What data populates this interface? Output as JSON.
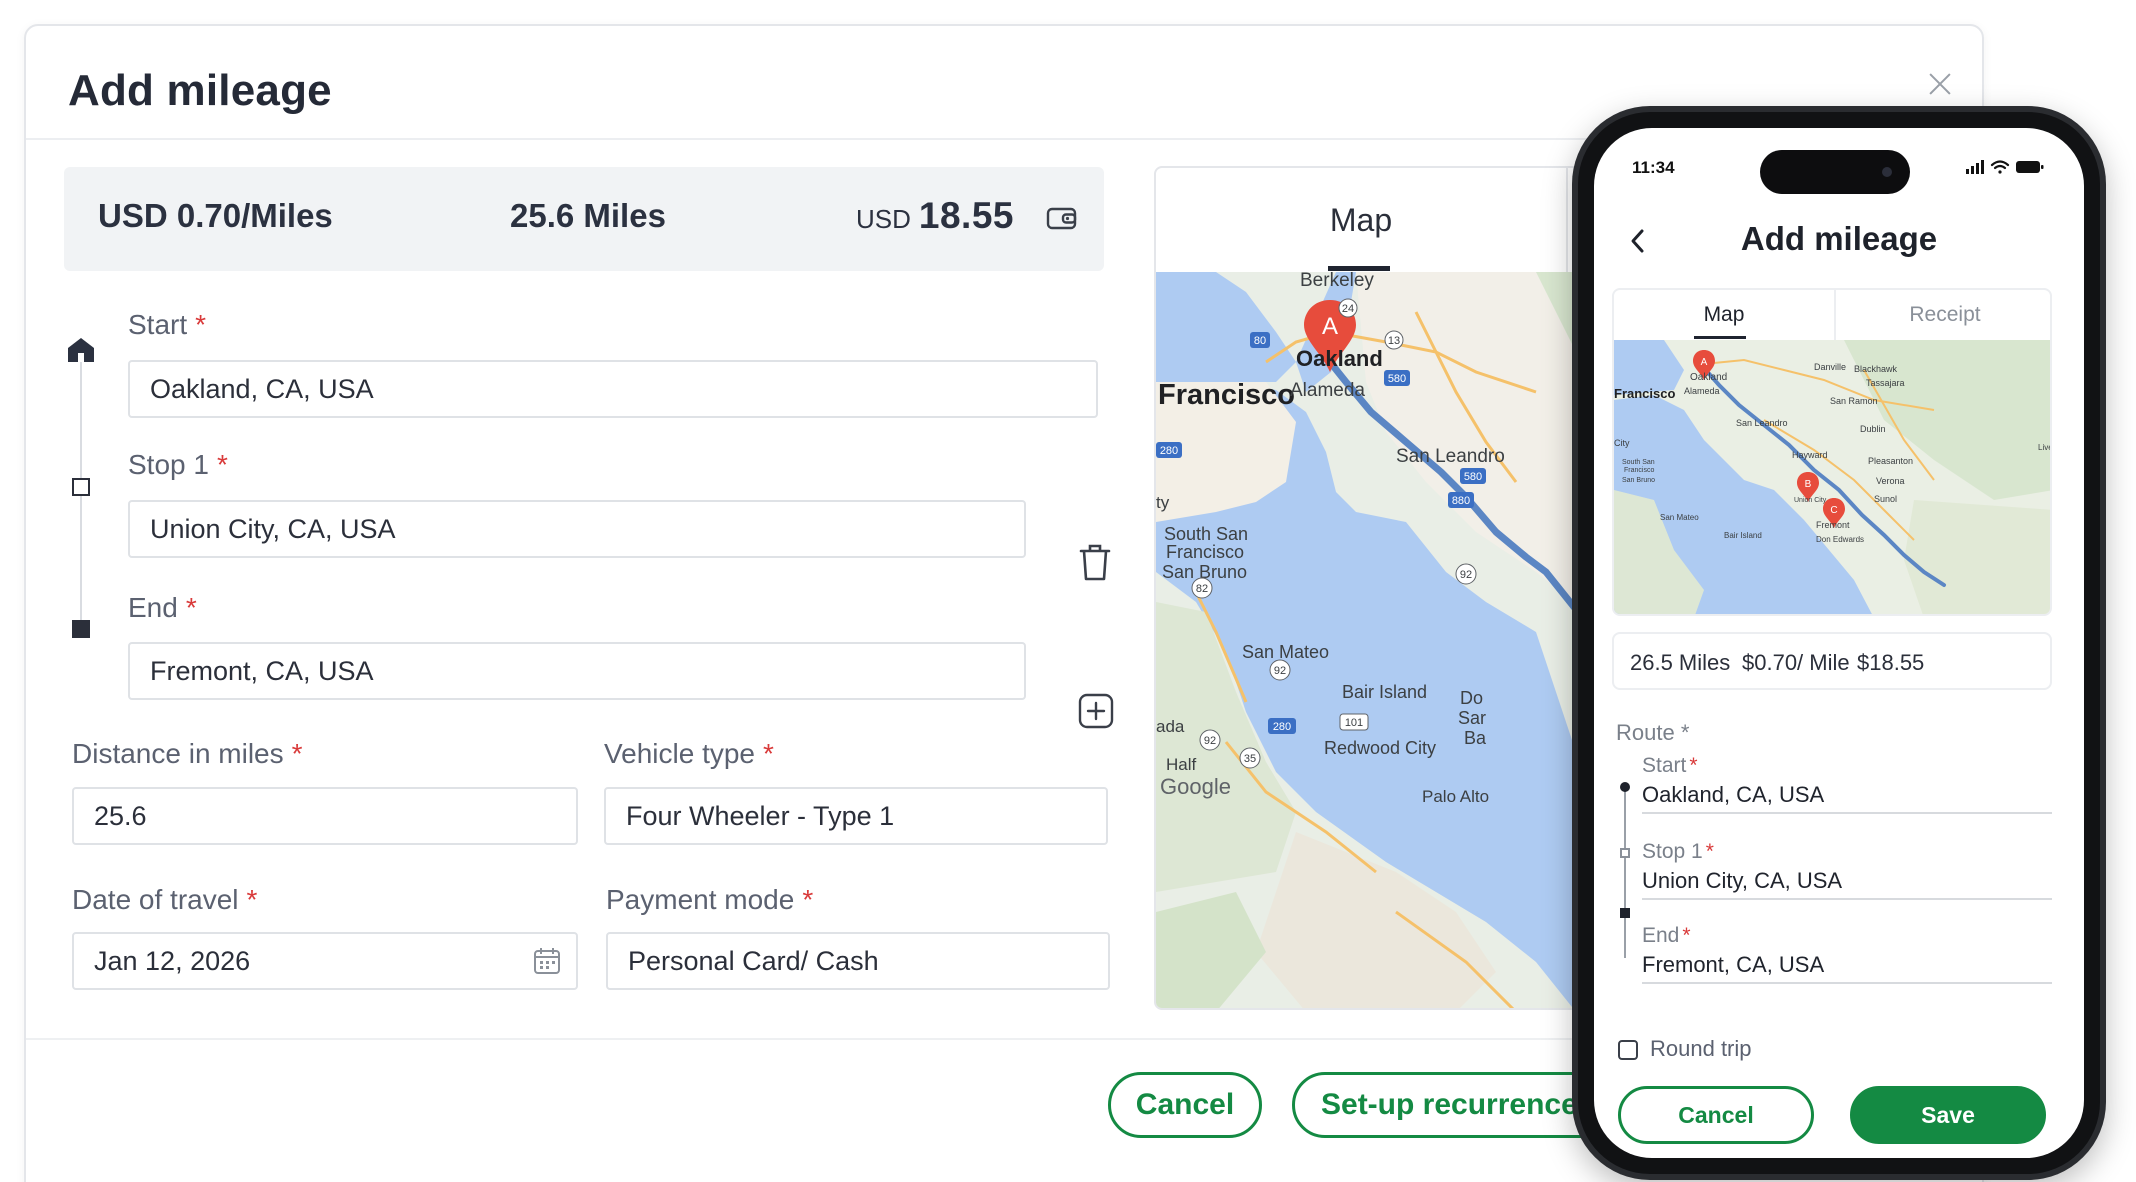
{
  "modal": {
    "title": "Add mileage",
    "summary": {
      "rate": "USD 0.70/Miles",
      "miles": "25.6 Miles",
      "total_currency": "USD",
      "total_amount": "18.55"
    },
    "route": {
      "start": {
        "label": "Start",
        "value": "Oakland, CA, USA"
      },
      "stop1": {
        "label": "Stop 1",
        "value": "Union City, CA, USA"
      },
      "end": {
        "label": "End",
        "value": "Fremont, CA, USA"
      }
    },
    "distance": {
      "label": "Distance in miles",
      "value": "25.6"
    },
    "vehicle": {
      "label": "Vehicle type",
      "value": "Four Wheeler - Type 1"
    },
    "date": {
      "label": "Date of travel",
      "value": "Jan 12, 2026"
    },
    "payment": {
      "label": "Payment mode",
      "value": "Personal Card/ Cash"
    },
    "required_mark": "*",
    "map_tab": "Map",
    "map_labels": {
      "berkeley": "Berkeley",
      "oakland": "Oakland",
      "francisco": "Francisco",
      "alameda": "Alameda",
      "san_leandro": "San Leandro",
      "south_sf_1": "South San",
      "south_sf_2": "Francisco",
      "san_bruno": "San Bruno",
      "san_mateo": "San Mateo",
      "bair_island": "Bair Island",
      "redwood_city": "Redwood City",
      "half": "Half",
      "ada": "ada",
      "ty": "ty",
      "do": "Do",
      "sar": "Sar",
      "ba": "Ba",
      "palo_alto": "Palo Alto",
      "google": "Google",
      "marker_a": "A"
    },
    "shields": [
      "80",
      "24",
      "13",
      "580",
      "280",
      "580",
      "880",
      "92",
      "82",
      "92",
      "101",
      "280",
      "92",
      "35"
    ],
    "buttons": {
      "cancel": "Cancel",
      "recurrence": "Set-up recurrence"
    }
  },
  "phone": {
    "time": "11:34",
    "title": "Add mileage",
    "tabs": {
      "map": "Map",
      "receipt": "Receipt"
    },
    "map_labels": {
      "francisco": "Francisco",
      "oakland": "Oakland",
      "alameda": "Alameda",
      "danville": "Danville",
      "blackhawk": "Blackhawk",
      "tassajara": "Tassajara",
      "san_ramon": "San Ramon",
      "dublin": "Dublin",
      "san_leandro": "San Leandro",
      "hayward": "Hayward",
      "pleasanton": "Pleasanton",
      "verona": "Verona",
      "sunol": "Sunol",
      "city": "City",
      "south_sf": "South San",
      "south_sf2": "Francisco",
      "san_bruno": "San Bruno",
      "union_city": "Union City",
      "fremont": "Fremont",
      "san_mateo": "San Mateo",
      "bair_island": "Bair Island",
      "don_edwards": "Don Edwards",
      "live": "Live",
      "marker_a": "A",
      "marker_b": "B",
      "marker_c": "C"
    },
    "summary": {
      "miles": "26.5 Miles",
      "rate": "$0.70/ Mile",
      "total": "$18.55"
    },
    "route_label": "Route *",
    "start": {
      "label": "Start",
      "value": "Oakland, CA, USA"
    },
    "stop1": {
      "label": "Stop 1",
      "value": "Union City, CA, USA"
    },
    "end": {
      "label": "End",
      "value": "Fremont, CA, USA"
    },
    "required_mark": "*",
    "round_trip": "Round trip",
    "buttons": {
      "cancel": "Cancel",
      "save": "Save"
    }
  },
  "colors": {
    "accent_green": "#148a43",
    "required_red": "#d93a3a",
    "map_water": "#aecbf2",
    "route_blue": "#5b86c4",
    "marker_red": "#e74c3c"
  },
  "icons": [
    "close-icon",
    "wallet-icon",
    "home-icon",
    "stop-square-icon",
    "end-square-icon",
    "trash-icon",
    "plus-square-icon",
    "calendar-icon",
    "chevron-left-icon",
    "signal-icon",
    "wifi-icon",
    "battery-icon",
    "map-marker-icon"
  ]
}
